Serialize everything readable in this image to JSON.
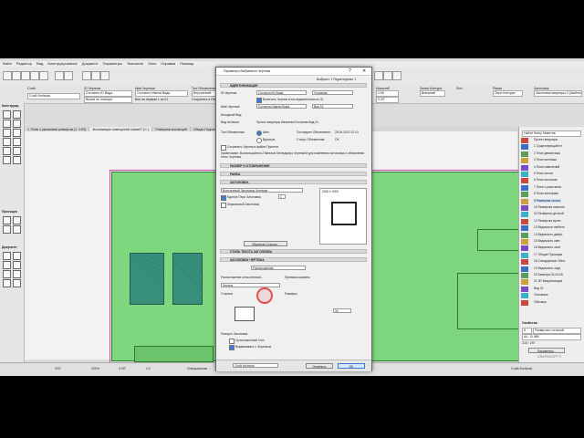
{
  "menu": [
    "Файл",
    "Редактор",
    "Вид",
    "Конструирование",
    "Документ",
    "Параметры",
    "Teamwork",
    "Окно",
    "Справка",
    "Помощь"
  ],
  "ribbon": {
    "layer_label": "Слой:",
    "layer_value": "Слой Archicad",
    "drawing_id_label": "ID Чертежа",
    "drawing_id_value": "Согласно ID Вида",
    "auto_value": "Вызов по позиции",
    "name_label": "Имя Чертежа",
    "name_value": "Согласно Имени Вида",
    "type_label": "Тип Обновления",
    "type_value": "Внутренний",
    "scale_label": "Масштаб",
    "scale_value": "1:50",
    "angle_value": "0,00°",
    "pen_label": "Перо Контура",
    "pen_value": "Внешний",
    "fill_label": "Фон",
    "frame_label": "Рамка",
    "cb_all_pages": "Все на первом 1 из 01",
    "cb_frame": "Сохранить в Рамку",
    "cb_title": "Заголовок",
    "title_value": "Заголовок квартиры 2 (Шаблон кв.)",
    "line_label": "Линия Контура"
  },
  "left_toolbar": {
    "title1": "Конструир.",
    "title2": "Проекция",
    "title3": "Документ"
  },
  "tabs": [
    "1. План с указанием развертки [1. 1:50]",
    "Экспликация помещений новая07 [Ч..]",
    "Развертки коллекций",
    "Общая Подготовка ....., Общие [1:15]"
  ],
  "navigator": {
    "title": "Найти Книгу Макетов",
    "items": [
      "Проект квартиры",
      "1 Существующий пл",
      "2 План демонтажа",
      "3 План монтажа",
      "4 План изменений",
      "5 План полов",
      "6 План потолков",
      "7 План с расстанов.",
      "8 План электрики",
      "9 Развертки гостин.",
      "10 Развертки спальни",
      "11 Развертки детской",
      "12 Развертки кухни",
      "13 Ведомость мебели",
      "14 Ведомость двери",
      "15 Ведомость свет.",
      "16 Ведомость окон",
      "17 Общие Проекции",
      "18 Стандартные Обоз.",
      "19 Ведомость отде.",
      "20 Баннера 03-04-05",
      "21 3D Визуализация",
      "Вид 21",
      "Основные",
      "Обложка"
    ],
    "properties_label": "Свойства",
    "prop_number": "8",
    "prop_name": "Развертки гостиной",
    "prop_size": "А4 - В 4ВУ",
    "prop_pages": "210 / 297",
    "settings_button": "Параметры...",
    "logo_text": "GRAPHISOFT ©"
  },
  "status": {
    "page": "9/37",
    "zoom": "200%",
    "angle": "0,00°",
    "scale": "1:2",
    "layer": "Слой Archicad",
    "note": "Специальная ..."
  },
  "dialog": {
    "title": "Параметры Выбранного Чертежа",
    "selected": "Выбрано: 1 Редактируемо: 1",
    "sec_ident": "ИДЕНТИФИКАЦИЯ",
    "id_label": "ID Чертежа",
    "id_value": "Согласно ID Вида",
    "id_right": "Условная",
    "cb_numbering": "Включить Чертеж в последовательность ID",
    "name_label": "Имя Чертежа",
    "name_value": "Согласно Имени Вида",
    "name_right": "Вид 01",
    "view_label": "Исходный Вид:",
    "archicad_label": "Вид Archicad",
    "archicad_value": "Проект квартиры Иваненко\\Гостиная Вид 01",
    "update_label": "Тип Обновления:",
    "auto": "Авто",
    "manual": "Вручную",
    "last_update_label": "Последнее Обновление:",
    "last_update_value": "25.04.2022 12:13",
    "status_label": "Статус Обновления:",
    "status_value": "OK",
    "cb_save_file": "Сохранить Чертеж в файле Проекта",
    "note": "Примечание: Воспользуйтесь Панелью Менеджера Чертежей для изменения источника и обновления этого Чертежа.",
    "sec_size": "РАЗМЕР И ОТОБРАЖЕНИЕ",
    "sec_frame": "РАМКА",
    "sec_title": "ЗАГОЛОВОК",
    "title_select": "Встроенный Заголовок Чертежа",
    "title_size": "2000 x 2000",
    "cb_title_pen": "Единое Перо Заголовка",
    "pen_num": "1",
    "cb_mirror": "Зеркальный Заголовок",
    "browse_button": "Обратная Ссылка...",
    "sec_style": "СТИЛЬ ТЕКСТА ЗАГОЛОВКА",
    "sec_label": "ЗАГОЛОВОК ЧЕРТЕЖА",
    "placement_dropdown": "Расположение...",
    "placement_label": "Расположение относительно...",
    "placement_value": "Чертеж",
    "width_label": "Привязка ширины",
    "side_label": "Сторона",
    "size_label": "Размеры",
    "size_value": "30",
    "rotate_label": "Поворот Заголовка",
    "cb_orth": "Ортогональный Угол",
    "cb_align": "Выравнивать с Чертежом",
    "footer_layer": "Слой Archicad",
    "cancel_button": "Отменить",
    "ok_button": "OK"
  }
}
